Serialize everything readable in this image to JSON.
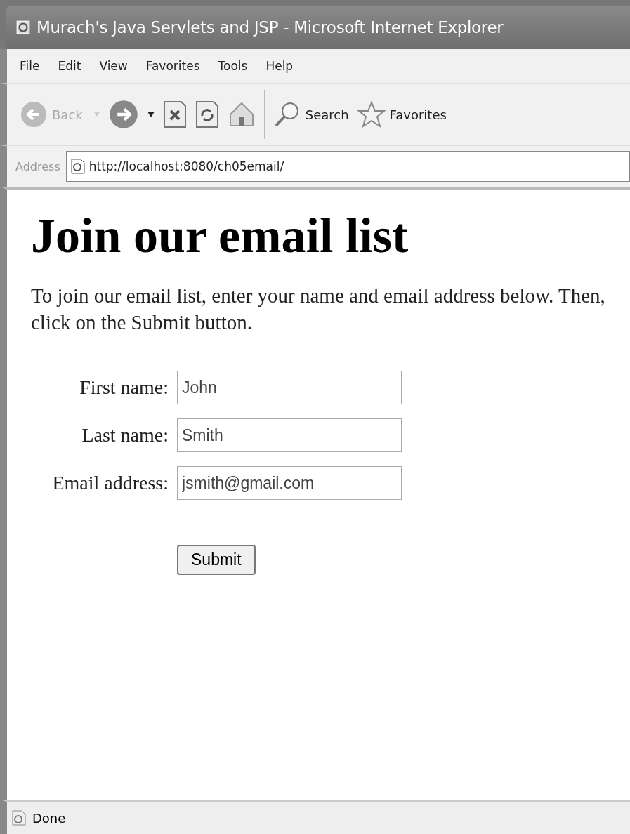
{
  "window": {
    "title": "Murach's Java Servlets and JSP - Microsoft Internet Explorer"
  },
  "menu": [
    "File",
    "Edit",
    "View",
    "Favorites",
    "Tools",
    "Help"
  ],
  "toolbar": {
    "back": {
      "label": "Back",
      "disabled": true
    },
    "search": "Search",
    "favorites": "Favorites"
  },
  "address": {
    "label": "Address",
    "url": "http://localhost:8080/ch05email/"
  },
  "page": {
    "heading": "Join our email list",
    "intro": "To join our email list, enter your name and email address below. Then, click on the Submit button.",
    "fields": [
      {
        "label": "First name:",
        "value": "John"
      },
      {
        "label": "Last name:",
        "value": "Smith"
      },
      {
        "label": "Email address:",
        "value": "jsmith@gmail.com"
      }
    ],
    "submit": "Submit"
  },
  "status_bar": {
    "text": "Done"
  }
}
